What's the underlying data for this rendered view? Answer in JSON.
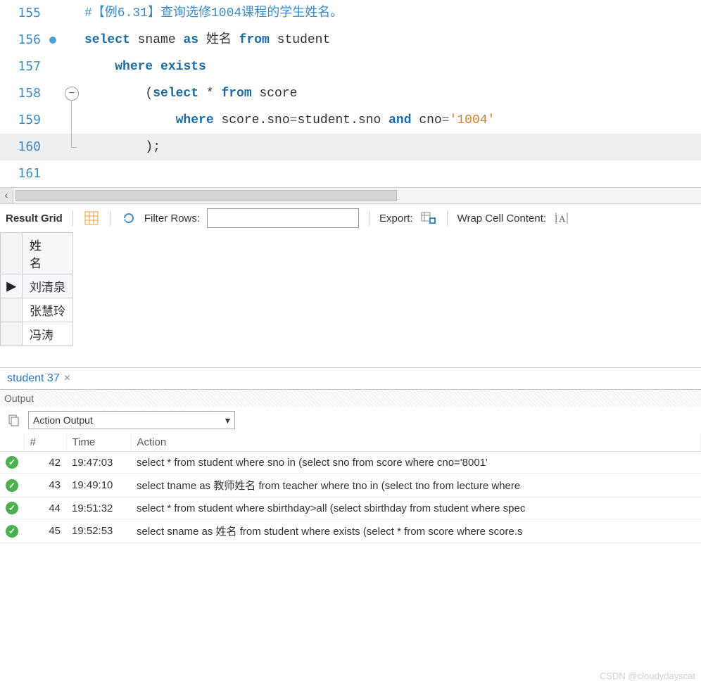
{
  "editor": {
    "rows": [
      {
        "line": "155",
        "marker": "",
        "fold": "",
        "cls": "",
        "tokens": [
          {
            "t": "#【例6.31】查询选修1004课程的学生姓名。",
            "c": "c-comment"
          }
        ]
      },
      {
        "line": "156",
        "marker": "dot",
        "fold": "",
        "cls": "",
        "tokens": [
          {
            "t": "select",
            "c": "c-keyword"
          },
          {
            "t": " sname ",
            "c": ""
          },
          {
            "t": "as",
            "c": "c-keyword"
          },
          {
            "t": " 姓名 ",
            "c": ""
          },
          {
            "t": "from",
            "c": "c-keyword"
          },
          {
            "t": " student",
            "c": ""
          }
        ]
      },
      {
        "line": "157",
        "marker": "",
        "fold": "",
        "cls": "",
        "tokens": [
          {
            "t": "    ",
            "c": ""
          },
          {
            "t": "where",
            "c": "c-keyword"
          },
          {
            "t": " ",
            "c": ""
          },
          {
            "t": "exists",
            "c": "c-keyword"
          }
        ]
      },
      {
        "line": "158",
        "marker": "",
        "fold": "start",
        "cls": "",
        "tokens": [
          {
            "t": "        (",
            "c": ""
          },
          {
            "t": "select",
            "c": "c-keyword"
          },
          {
            "t": " * ",
            "c": ""
          },
          {
            "t": "from",
            "c": "c-keyword"
          },
          {
            "t": " score",
            "c": ""
          }
        ]
      },
      {
        "line": "159",
        "marker": "",
        "fold": "mid",
        "cls": "",
        "tokens": [
          {
            "t": "            ",
            "c": ""
          },
          {
            "t": "where",
            "c": "c-keyword"
          },
          {
            "t": " score.sno",
            "c": ""
          },
          {
            "t": "=",
            "c": "c-weak"
          },
          {
            "t": "student.sno ",
            "c": ""
          },
          {
            "t": "and",
            "c": "c-keyword"
          },
          {
            "t": " cno",
            "c": ""
          },
          {
            "t": "=",
            "c": "c-weak"
          },
          {
            "t": "'1004'",
            "c": "c-string"
          }
        ]
      },
      {
        "line": "160",
        "marker": "",
        "fold": "end",
        "cls": "row-hl",
        "tokens": [
          {
            "t": "        );",
            "c": ""
          }
        ]
      },
      {
        "line": "161",
        "marker": "",
        "fold": "",
        "cls": "",
        "tokens": []
      }
    ]
  },
  "toolbar": {
    "result_grid": "Result Grid",
    "filter_label": "Filter Rows:",
    "filter_value": "",
    "export_label": "Export:",
    "wrap_label": "Wrap Cell Content:"
  },
  "grid": {
    "header": "姓\n名",
    "rows": [
      {
        "ptr": "▶",
        "val": "刘清泉",
        "cls": "current"
      },
      {
        "ptr": "",
        "val": "张慧玲",
        "cls": ""
      },
      {
        "ptr": "",
        "val": "冯涛",
        "cls": ""
      }
    ]
  },
  "tab": {
    "label": "student 37",
    "close": "×"
  },
  "output": {
    "title": "Output",
    "dropdown": "Action Output",
    "columns": {
      "idx": "#",
      "time": "Time",
      "action": "Action"
    },
    "rows": [
      {
        "idx": "42",
        "time": "19:47:03",
        "action": "select * from student where sno in  (select sno from score          where cno='8001'"
      },
      {
        "idx": "43",
        "time": "19:49:10",
        "action": "select tname as 教师姓名 from teacher where tno in (select tno from lecture where"
      },
      {
        "idx": "44",
        "time": "19:51:32",
        "action": "select * from student where sbirthday>all (select sbirthday from student where spec"
      },
      {
        "idx": "45",
        "time": "19:52:53",
        "action": "select sname as 姓名 from student where exists (select * from score  where  score.s"
      }
    ]
  },
  "watermark": "CSDN @cloudydayscat"
}
